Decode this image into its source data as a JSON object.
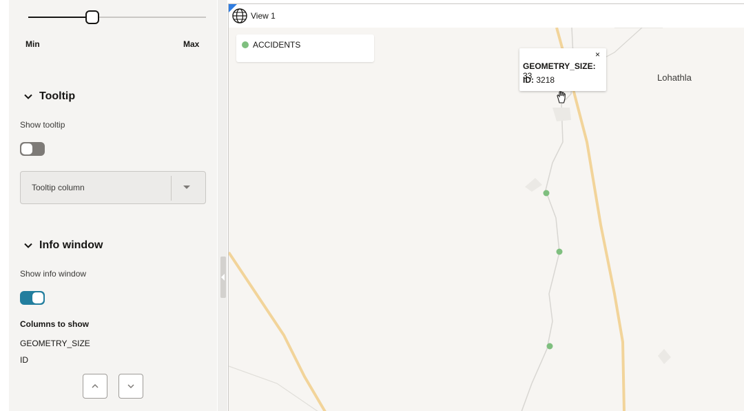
{
  "slider": {
    "min_label": "Min",
    "max_label": "Max",
    "value_fraction": 0.36
  },
  "tooltip_section": {
    "title": "Tooltip",
    "show_label": "Show tooltip",
    "show_enabled": false,
    "column_select_value": "Tooltip column"
  },
  "info_section": {
    "title": "Info window",
    "show_label": "Show info window",
    "show_enabled": true,
    "columns_label": "Columns to show",
    "columns": [
      "GEOMETRY_SIZE",
      "ID"
    ]
  },
  "map": {
    "view_title": "View 1",
    "legend_label": "ACCIDENTS",
    "legend_color": "#7fbf7f",
    "place_label": "Lohathla",
    "popup": {
      "close": "×",
      "rows": [
        {
          "key": "GEOMETRY_SIZE:",
          "value": "33"
        },
        {
          "key": "ID:",
          "value": "3218"
        }
      ]
    }
  },
  "colors": {
    "accent": "#227e9e",
    "view_corner": "#2f7de1",
    "road": "#f2d49a",
    "point": "#7fbf7f"
  }
}
